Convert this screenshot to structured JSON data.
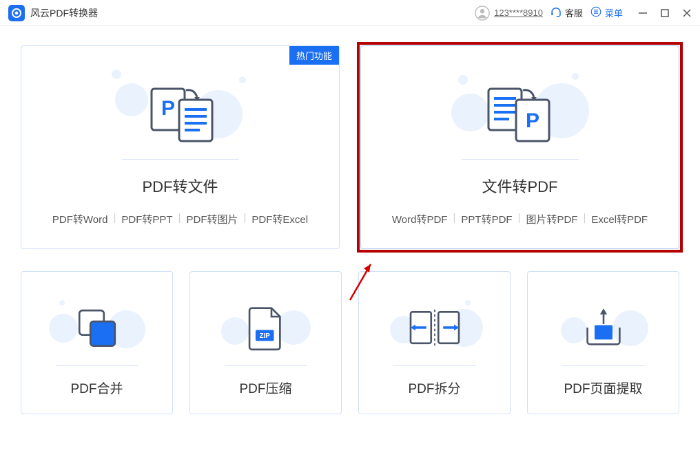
{
  "titlebar": {
    "app_title": "风云PDF转换器",
    "username": "123****8910",
    "service_label": "客服",
    "menu_label": "菜单"
  },
  "cards": {
    "pdf_to_file": {
      "title": "PDF转文件",
      "badge": "热门功能",
      "subs": [
        "PDF转Word",
        "PDF转PPT",
        "PDF转图片",
        "PDF转Excel"
      ]
    },
    "file_to_pdf": {
      "title": "文件转PDF",
      "subs": [
        "Word转PDF",
        "PPT转PDF",
        "图片转PDF",
        "Excel转PDF"
      ]
    },
    "merge": {
      "title": "PDF合并"
    },
    "compress": {
      "title": "PDF压缩",
      "zip_label": "ZIP"
    },
    "split": {
      "title": "PDF拆分"
    },
    "extract": {
      "title": "PDF页面提取"
    }
  }
}
